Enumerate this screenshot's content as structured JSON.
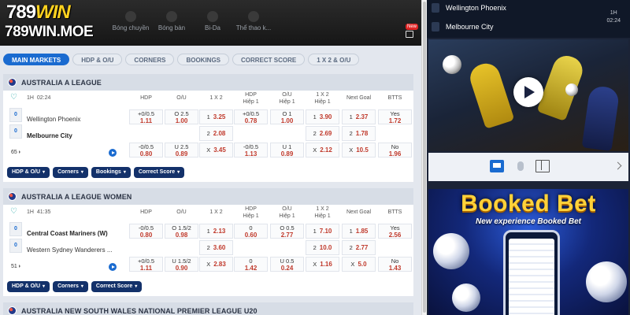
{
  "header": {
    "logo_line1": "789",
    "logo_line1_accent": "WIN",
    "logo_line2": "789WIN.MOE",
    "sports": [
      "Bóng chuyền",
      "Bóng bàn",
      "Bi-Da",
      "Thể thao k..."
    ],
    "new_label": "New"
  },
  "tabs": [
    "MAIN MARKETS",
    "HDP & O/U",
    "CORNERS",
    "BOOKINGS",
    "CORRECT SCORE",
    "1 X 2 & O/U"
  ],
  "market_headers": [
    {
      "l1": "HDP",
      "l2": ""
    },
    {
      "l1": "O/U",
      "l2": ""
    },
    {
      "l1": "1 X 2",
      "l2": ""
    },
    {
      "l1": "HDP",
      "l2": "Hiệp 1"
    },
    {
      "l1": "O/U",
      "l2": "Hiệp 1"
    },
    {
      "l1": "1 X 2",
      "l2": "Hiệp 1"
    },
    {
      "l1": "Next Goal",
      "l2": ""
    },
    {
      "l1": "BTTS",
      "l2": ""
    }
  ],
  "sections": [
    {
      "title": "AUSTRALIA A LEAGUE",
      "match": {
        "half": "1H",
        "clock": "02:24",
        "home": "Wellington Phoenix",
        "away": "Melbourne City",
        "home_score": "0",
        "away_score": "0",
        "more_count": "65",
        "rows": [
          [
            {
              "a": "+0/0.5",
              "b": "1.11"
            },
            {
              "a": "O 2.5",
              "b": "1.00"
            },
            {
              "a": "1",
              "b": "3.25"
            },
            {
              "a": "+0/0.5",
              "b": "0.78"
            },
            {
              "a": "O 1",
              "b": "1.00"
            },
            {
              "a": "1",
              "b": "3.90"
            },
            {
              "a": "1",
              "b": "2.37"
            },
            {
              "a": "Yes",
              "b": "1.72"
            }
          ],
          [
            {
              "a": "",
              "b": ""
            },
            {
              "a": "",
              "b": ""
            },
            {
              "a": "2",
              "b": "2.08"
            },
            {
              "a": "",
              "b": ""
            },
            {
              "a": "",
              "b": ""
            },
            {
              "a": "2",
              "b": "2.69"
            },
            {
              "a": "2",
              "b": "1.78"
            },
            {
              "a": "",
              "b": ""
            }
          ],
          [
            {
              "a": "-0/0.5",
              "b": "0.80"
            },
            {
              "a": "U 2.5",
              "b": "0.89"
            },
            {
              "a": "X",
              "b": "3.45"
            },
            {
              "a": "-0/0.5",
              "b": "1.13"
            },
            {
              "a": "U 1",
              "b": "0.89"
            },
            {
              "a": "X",
              "b": "2.12"
            },
            {
              "a": "X",
              "b": "10.5"
            },
            {
              "a": "No",
              "b": "1.96"
            }
          ]
        ],
        "chips": [
          "HDP & O/U",
          "Corners",
          "Bookings",
          "Correct Score"
        ]
      }
    },
    {
      "title": "AUSTRALIA A LEAGUE WOMEN",
      "match": {
        "half": "1H",
        "clock": "41:35",
        "home": "Central Coast Mariners (W)",
        "away": "Western Sydney Wanderers ...",
        "home_score": "0",
        "away_score": "0",
        "more_count": "51",
        "rows": [
          [
            {
              "a": "-0/0.5",
              "b": "0.80"
            },
            {
              "a": "O 1.5/2",
              "b": "0.98"
            },
            {
              "a": "1",
              "b": "2.13"
            },
            {
              "a": "0",
              "b": "0.60"
            },
            {
              "a": "O 0.5",
              "b": "2.77"
            },
            {
              "a": "1",
              "b": "7.10"
            },
            {
              "a": "1",
              "b": "1.85"
            },
            {
              "a": "Yes",
              "b": "2.56"
            }
          ],
          [
            {
              "a": "",
              "b": ""
            },
            {
              "a": "",
              "b": ""
            },
            {
              "a": "2",
              "b": "3.60"
            },
            {
              "a": "",
              "b": ""
            },
            {
              "a": "",
              "b": ""
            },
            {
              "a": "2",
              "b": "10.0"
            },
            {
              "a": "2",
              "b": "2.77"
            },
            {
              "a": "",
              "b": ""
            }
          ],
          [
            {
              "a": "+0/0.5",
              "b": "1.11"
            },
            {
              "a": "U 1.5/2",
              "b": "0.90"
            },
            {
              "a": "X",
              "b": "2.83"
            },
            {
              "a": "0",
              "b": "1.42"
            },
            {
              "a": "U 0.5",
              "b": "0.24"
            },
            {
              "a": "X",
              "b": "1.16"
            },
            {
              "a": "X",
              "b": "5.0"
            },
            {
              "a": "No",
              "b": "1.43"
            }
          ]
        ],
        "chips": [
          "HDP & O/U",
          "Corners",
          "Correct Score"
        ]
      }
    },
    {
      "title": "AUSTRALIA NEW SOUTH WALES NATIONAL PREMIER LEAGUE U20"
    }
  ],
  "right_panel": {
    "home": "Wellington Phoenix",
    "away": "Melbourne City",
    "half": "1H",
    "clock": "02:24",
    "banner_title": "Booked Bet",
    "banner_subtitle": "New experience Booked Bet"
  },
  "colors": {
    "accent": "#1a6bd0",
    "odds": "#c0392b",
    "chip": "#13316a",
    "banner_gold": "#ffd23a"
  }
}
